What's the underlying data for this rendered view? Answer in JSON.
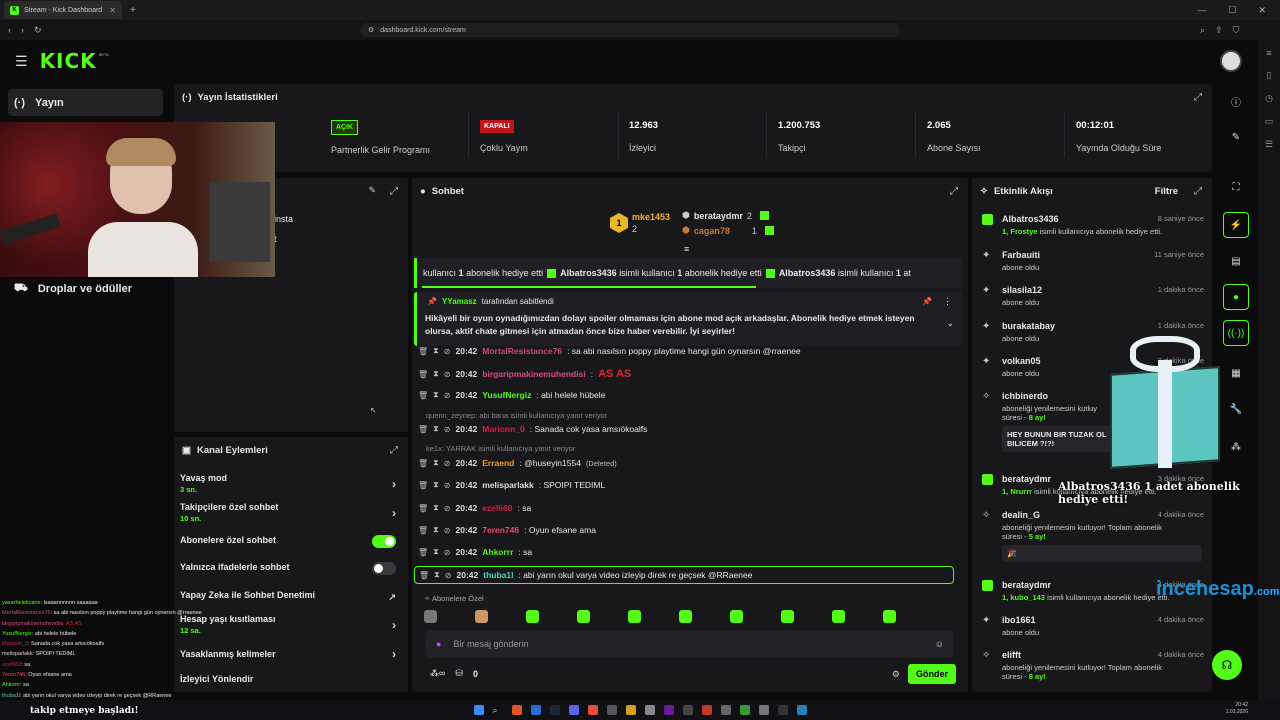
{
  "browser": {
    "tab_title": "Stream - Kick Dashboard",
    "url": "dashboard.kick.com/stream"
  },
  "header": {
    "logo": "KICK",
    "beta": "BETA"
  },
  "nav": {
    "items": [
      {
        "label": "Yayın",
        "icon": "(·)"
      },
      {
        "label": "Droplar ve ödüller",
        "icon": "⛟"
      }
    ]
  },
  "stats": {
    "title": "Yayın İstatistikleri",
    "partner": {
      "badge": "AÇIK",
      "label": "Partnerlik Gelir Programı"
    },
    "multistream": {
      "badge": "KAPALI",
      "label": "Çoklu Yayın"
    },
    "viewers": {
      "value": "12.963",
      "label": "İzleyici"
    },
    "followers": {
      "value": "1.200.753",
      "label": "Takipçi"
    },
    "subs": {
      "value": "2.065",
      "label": "Abone Sayısı"
    },
    "uptime": {
      "value": "00:12:01",
      "label": "Yayında Olduğu Süre"
    }
  },
  "topleft": {
    "line1": "insta",
    "line2": "t"
  },
  "channel_actions": {
    "title": "Kanal Eylemleri",
    "items": [
      {
        "label": "Yavaş mod",
        "sub": "3 sn.",
        "control": "chevron"
      },
      {
        "label": "Takipçilere özel sohbet",
        "sub": "10 sn.",
        "control": "chevron"
      },
      {
        "label": "Abonelere özel sohbet",
        "sub": "",
        "control": "toggle-on"
      },
      {
        "label": "Yalnızca ifadelerle sohbet",
        "sub": "",
        "control": "toggle-off"
      },
      {
        "label": "Yapay Zeka ile Sohbet Denetimi",
        "sub": "",
        "control": "external"
      },
      {
        "label": "Hesap yaşı kısıtlaması",
        "sub": "12 sa.",
        "control": "chevron"
      },
      {
        "label": "Yasaklanmış kelimeler",
        "sub": "",
        "control": "chevron"
      },
      {
        "label": "İzleyici Yönlendir",
        "sub": "",
        "control": "none"
      }
    ]
  },
  "chat": {
    "title": "Sohbet",
    "leaders": [
      {
        "rank": "1",
        "name": "mke1453",
        "count": "2"
      },
      {
        "rank": "",
        "name": "berataydmr",
        "count": "2"
      },
      {
        "rank": "",
        "name": "cagan78",
        "count": "1"
      }
    ],
    "ticker": {
      "lead": "kullanıcı",
      "count1": "1",
      "text1": "abonelik hediye etti",
      "user1": "Albatros3436",
      "mid1": "isimli kullanıcı",
      "count2": "1",
      "text2": "abonelik hediye etti",
      "user2": "Albatros3436",
      "mid2": "isimli kullanıcı",
      "count3": "1",
      "tail": "at"
    },
    "pinned": {
      "by": "YYamasz",
      "by_suffix": "tarafından sabitlendi",
      "text": "Hikâyeli bir oyun oynadığımızdan dolayı spoiler olmaması için abone mod açık arkadaşlar. Abonelik hediye etmek isteyen olursa, aktif chate gitmesi için atmadan önce bize haber verebilir. İyi seyirler!"
    },
    "messages": [
      {
        "time": "20:42",
        "user": "MortalResistance76",
        "color": "#c94b74",
        "text": ": sa abi nasılsın poppy playtime hangi gün oynarsın @rraenee"
      },
      {
        "time": "20:42",
        "user": "birgaripmakinemuhendisi",
        "color": "#d94a8a",
        "text": ":",
        "emote": "AS AS"
      },
      {
        "time": "20:42",
        "user": "YusufNergiz",
        "color": "#53fc18",
        "text": ": abi helele hübele"
      },
      {
        "time": "20:42",
        "user": "Marionn_0",
        "color": "#c8234a",
        "text": ": Sanada cok yasa amsıökoalfs"
      },
      {
        "time": "20:42",
        "user": "Erraend",
        "color": "#f0a020",
        "text": ": @huseyin1554",
        "deleted": "(Deleted)"
      },
      {
        "time": "20:42",
        "user": "melisparlakk",
        "color": "#dddddd",
        "text": ": SPOIPI TEDIML"
      },
      {
        "time": "20:42",
        "user": "ezel660",
        "color": "#c8234a",
        "text": ": sa"
      },
      {
        "time": "20:42",
        "user": "7eren746",
        "color": "#e84a6a",
        "text": ": Oyun efsane ama"
      },
      {
        "time": "20:42",
        "user": "Ahkorrr",
        "color": "#53fc18",
        "text": ": sa"
      },
      {
        "time": "20:42",
        "user": "thuba1l",
        "color": "#4fd1c5",
        "text": ": abi yarın okul varya video izleyip direk re geçsek @RRaenee"
      }
    ],
    "replies": [
      "quenn_zeynep: abi bana isimli kullanıcıya yanıt veriyor",
      "ke1x: YARRAK isimli kullanıcıya yanıt veriyor"
    ],
    "emote_section": "Abonelere Özel",
    "input_placeholder": "Bir mesaj gönderin",
    "points": "0",
    "send": "Gönder"
  },
  "activity": {
    "title": "Etkinlik Akışı",
    "filter": "Filtre",
    "items": [
      {
        "type": "gift",
        "name": "Albatros3436",
        "time": "8 saniye önce",
        "count": "1,",
        "target": "Frostye",
        "text": "isimli kullanıcıya abonelik hediye etti."
      },
      {
        "type": "star",
        "name": "Farbauiti",
        "time": "11 saniye önce",
        "text": "abone oldu"
      },
      {
        "type": "star",
        "name": "silasila12",
        "time": "1 dakika önce",
        "text": "abone oldu"
      },
      {
        "type": "star",
        "name": "burakatabay",
        "time": "1 dakika önce",
        "text": "abone oldu"
      },
      {
        "type": "star",
        "name": "volkan05",
        "time": "2 dakika önce",
        "text": "abone oldu"
      },
      {
        "type": "renew",
        "name": "ichbinerdo",
        "time": "",
        "text": "aboneliği yenilemesini kutluy",
        "text2": "süresi -",
        "months": "8 ay!",
        "message": "HEY BUNUN BIR TUZAK OL",
        "message2": "BILICEM ?!?!"
      },
      {
        "type": "gift",
        "name": "berataydmr",
        "time": "3 dakika önce",
        "count": "1,",
        "target": "Nrurrr",
        "text": "isimli kullanıcıya abonelik hediye etti."
      },
      {
        "type": "renew",
        "name": "dealin_G",
        "time": "4 dakika önce",
        "text": "aboneliği yenilemesini kutluyor! Toplam abonelik",
        "text2": "süresi -",
        "months": "5 ay!",
        "message": "🎉"
      },
      {
        "type": "gift",
        "name": "berataydmr",
        "time": "4 dakika önce",
        "count": "1,",
        "target": "kubo_143",
        "text": "isimli kullanıcıya abonelik hediye etti."
      },
      {
        "type": "star",
        "name": "ibo1661",
        "time": "4 dakika önce",
        "text": "abone oldu"
      },
      {
        "type": "renew",
        "name": "elifft",
        "time": "4 dakika önce",
        "text": "aboneliği yenilemesini kutluyor! Toplam abonelik",
        "text2": "süresi -",
        "months": "8 ay!"
      }
    ]
  },
  "overlay": {
    "gift_text": "Albatros3436 1 adet abonelik hediye etti!",
    "watermark": "incehesap",
    "watermark_suffix": ".com",
    "bottom_text": "takip etmeye başladı!",
    "chat_lines": [
      {
        "user": "yasarhelekcane",
        "text": ": lsaaannnnnn saaaaaa"
      },
      {
        "user": "MortalResistance76",
        "text": ": sa abi nasılsın poppy playtime hangi gün oynarsın @rraenee"
      },
      {
        "user": "birgaripmakinemuhendisi",
        "text": ": AS AS"
      },
      {
        "user": "YusufNergiz",
        "text": ": abi helele hübele"
      },
      {
        "user": "Marionn_0",
        "text": ": Sanada cok yasa amsıökoalfs"
      },
      {
        "user": "melisparlakk",
        "text": ": SPOIPI TEDIML"
      },
      {
        "user": "ezel660",
        "text": ": sa"
      },
      {
        "user": "7eren746",
        "text": ": Oyun efsane ama"
      },
      {
        "user": "Ahkorrr",
        "text": ": sa"
      },
      {
        "user": "thuba1l",
        "text": ": abi yarın okul varya video izleyip direk re geçsek @RRaenee"
      }
    ]
  },
  "taskbar": {
    "time": "20:42",
    "date": "1.03.2026"
  },
  "colors": {
    "accent": "#53fc18",
    "panel": "#18181b",
    "background": "#0b0b0c",
    "danger": "#c0131b"
  }
}
